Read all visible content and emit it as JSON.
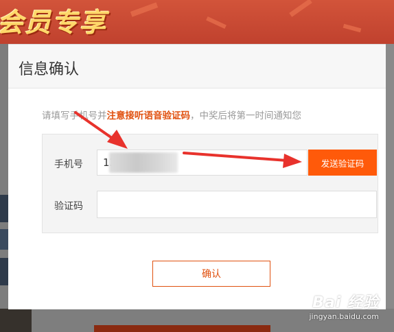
{
  "background": {
    "banner_text": "会员专享"
  },
  "modal": {
    "title": "信息确认",
    "notice": {
      "before": "请填写手机号并",
      "highlight": "注意接听语音验证码",
      "after": "，中奖后将第一时间通知您"
    },
    "phone": {
      "label": "手机号",
      "value": "13"
    },
    "send_code_label": "发送验证码",
    "code": {
      "label": "验证码",
      "value": ""
    },
    "confirm_label": "确认"
  },
  "watermark": {
    "brand": "Bai 经验",
    "url": "jingyan.baidu.com"
  },
  "colors": {
    "accent": "#ff5a0a",
    "highlight_text": "#e0500e",
    "annotation_arrow": "#e8322c"
  }
}
